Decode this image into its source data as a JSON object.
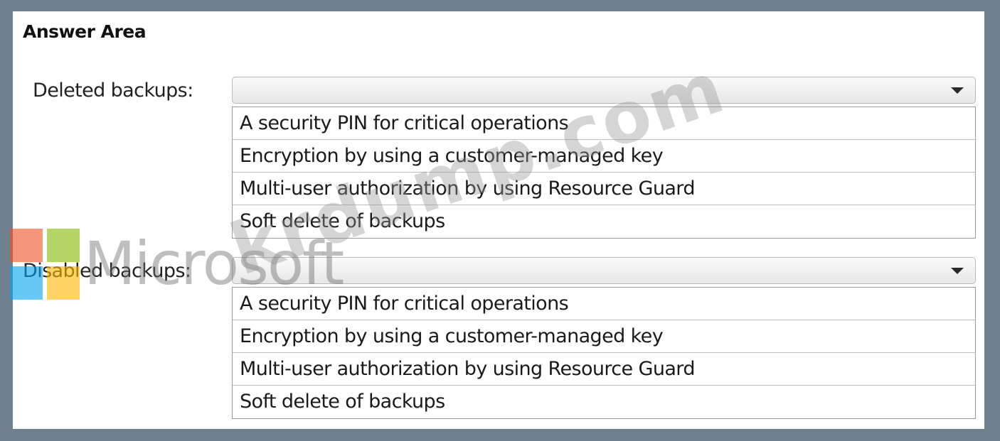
{
  "answer_area": {
    "title": "Answer Area"
  },
  "deleted": {
    "label": "Deleted backups:",
    "selected": "",
    "options": [
      "A security PIN for critical operations",
      "Encryption by using a customer-managed key",
      "Multi-user authorization by using Resource Guard",
      "Soft delete of backups"
    ]
  },
  "disabled": {
    "label": "Disabled backups:",
    "selected": "",
    "options": [
      "A security PIN for critical operations",
      "Encryption by using a customer-managed key",
      "Multi-user authorization by using Resource Guard",
      "Soft delete of backups"
    ]
  },
  "watermark": {
    "brand": "Microsoft",
    "site": "krdump.com",
    "logo_colors": [
      "#f25022",
      "#7fba00",
      "#00a4ef",
      "#ffb900"
    ]
  },
  "icons": {
    "dropdown": "chevron-down-icon"
  }
}
